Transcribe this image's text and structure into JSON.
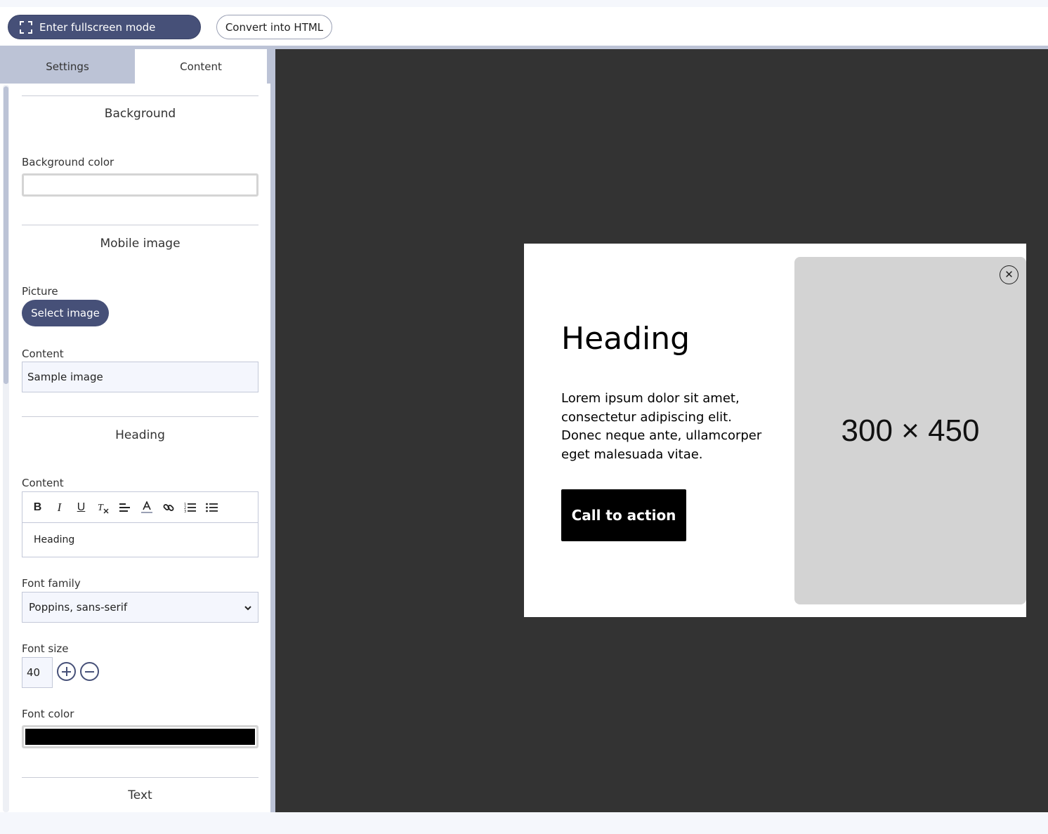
{
  "toolbar": {
    "fullscreen_label": "Enter fullscreen mode",
    "convert_label": "Convert into HTML"
  },
  "tabs": [
    {
      "label": "Settings",
      "active": false
    },
    {
      "label": "Content",
      "active": true
    }
  ],
  "background_section": {
    "title": "Background",
    "color_label": "Background color",
    "color_value": "#ffffff"
  },
  "mobile_image_section": {
    "title": "Mobile image",
    "picture_label": "Picture",
    "select_button": "Select image",
    "content_label": "Content",
    "content_value": "Sample image"
  },
  "heading_section": {
    "title": "Heading",
    "content_label": "Content",
    "editor_tools": [
      "bold-icon",
      "italic-icon",
      "underline-icon",
      "clear-format-icon",
      "align-icon",
      "font-color-icon",
      "link-icon",
      "ordered-list-icon",
      "bullet-list-icon"
    ],
    "editor_text": "Heading",
    "font_family_label": "Font family",
    "font_family_value": "Poppins, sans-serif",
    "font_size_label": "Font size",
    "font_size_value": "40",
    "font_color_label": "Font color",
    "font_color_value": "#000000"
  },
  "text_section": {
    "title": "Text"
  },
  "preview": {
    "heading": "Heading",
    "body": "Lorem ipsum dolor sit amet, consectetur adipiscing elit. Donec neque ante, ullamcorper eget malesuada vitae.",
    "cta": "Call to action",
    "image_placeholder": "300 × 450"
  },
  "colors": {
    "accent": "#465078",
    "sidebar_bg": "#bcc3d6",
    "canvas_bg": "#333333",
    "image_bg": "#d3d3d3"
  }
}
